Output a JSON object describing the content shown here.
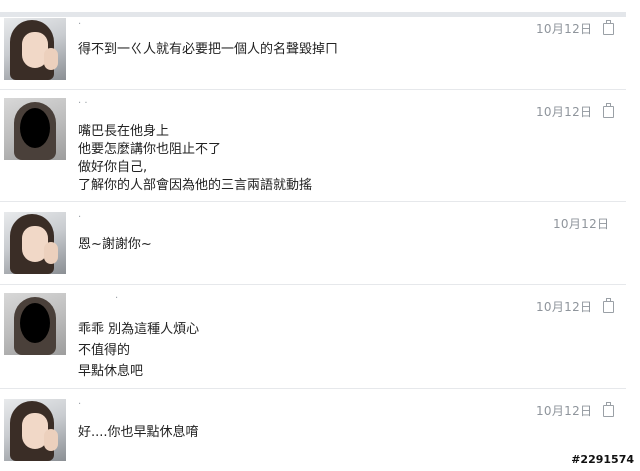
{
  "messages": [
    {
      "avatar": "girl-avatar",
      "name": "·",
      "date": "10月12日",
      "deletable": true,
      "lines": [
        "得不到一ㄍ人就有必要把一個人的名聲毀掉ㄇ"
      ]
    },
    {
      "avatar": "censored-avatar",
      "name": "· ·",
      "date": "10月12日",
      "deletable": true,
      "lines": [
        "嘴巴長在他身上",
        "他要怎麼講你也阻止不了",
        "做好你自己,",
        "了解你的人部會因為他的三言兩語就動搖"
      ]
    },
    {
      "avatar": "girl-avatar",
      "name": "·",
      "date": "10月12日",
      "deletable": false,
      "lines": [
        "恩~謝謝你~"
      ]
    },
    {
      "avatar": "censored-avatar",
      "name": "·",
      "date": "10月12日",
      "deletable": true,
      "lines": [
        "乖乖 別為這種人煩心",
        "不值得的",
        "早點休息吧"
      ]
    },
    {
      "avatar": "girl-avatar",
      "name": "·",
      "date": "10月12日",
      "deletable": true,
      "lines": [
        "好....你也早點休息唷"
      ]
    }
  ],
  "watermark": "#2291574",
  "icons": {
    "delete": "trash-icon"
  }
}
